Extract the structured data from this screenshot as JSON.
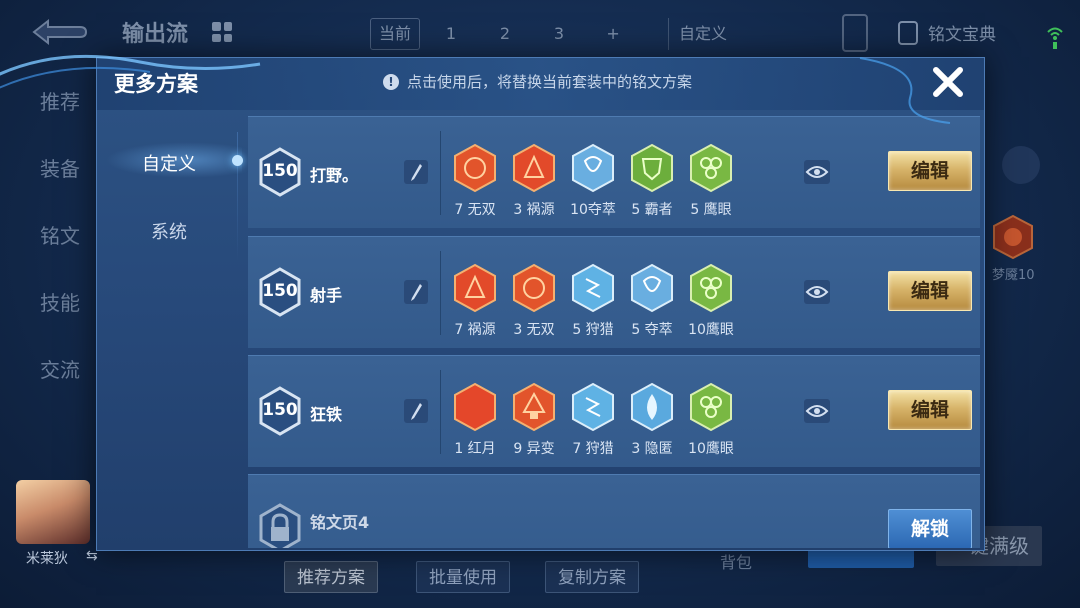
{
  "background": {
    "title": "输出流",
    "tabs": [
      "当前",
      "1",
      "2",
      "3",
      "+"
    ],
    "custom_tab": "自定义",
    "rune_book": "铭文宝典",
    "left_nav": [
      "推荐",
      "装备",
      "铭文",
      "技能",
      "交流"
    ],
    "right_rune_label": "梦魇10",
    "hero_name": "米莱狄",
    "swap_icon": "⇆",
    "bottom_buttons": [
      "推荐方案",
      "批量使用",
      "复制方案"
    ],
    "bag": "背包",
    "max_level": "一键满级"
  },
  "modal": {
    "title": "更多方案",
    "notice": "点击使用后，将替换当前套装中的铭文方案",
    "info_glyph": "!",
    "side_nav": [
      {
        "label": "自定义",
        "active": true
      },
      {
        "label": "系统",
        "active": false
      }
    ],
    "plans": [
      {
        "level": "150",
        "name": "打野。",
        "action": "编辑",
        "runes": [
          {
            "label": "7 无双",
            "color": "#e2542b",
            "icon": "wushuang-rune-icon"
          },
          {
            "label": "3 祸源",
            "color": "#e24a2a",
            "icon": "huoyuan-rune-icon"
          },
          {
            "label": "10夺萃",
            "color": "#69aee0",
            "icon": "duocui-rune-icon"
          },
          {
            "label": "5 霸者",
            "color": "#6cae3c",
            "icon": "bazhe-rune-icon"
          },
          {
            "label": "5 鹰眼",
            "color": "#79b843",
            "icon": "yingyan-rune-icon"
          }
        ]
      },
      {
        "level": "150",
        "name": "射手",
        "action": "编辑",
        "runes": [
          {
            "label": "7 祸源",
            "color": "#e24a2a",
            "icon": "huoyuan-rune-icon"
          },
          {
            "label": "3 无双",
            "color": "#e2542b",
            "icon": "wushuang-rune-icon"
          },
          {
            "label": "5 狩猎",
            "color": "#5fb2e4",
            "icon": "shoulie-rune-icon"
          },
          {
            "label": "5 夺萃",
            "color": "#69aee0",
            "icon": "duocui-rune-icon"
          },
          {
            "label": "10鹰眼",
            "color": "#79b843",
            "icon": "yingyan-rune-icon"
          }
        ]
      },
      {
        "level": "150",
        "name": "狂铁",
        "action": "编辑",
        "runes": [
          {
            "label": "1 红月",
            "color": "#e4472a",
            "icon": "hongyue-rune-icon"
          },
          {
            "label": "9 异变",
            "color": "#e2542b",
            "icon": "yibian-rune-icon"
          },
          {
            "label": "7 狩猎",
            "color": "#5fb2e4",
            "icon": "shoulie-rune-icon"
          },
          {
            "label": "3 隐匿",
            "color": "#5aa9de",
            "icon": "yinni-rune-icon"
          },
          {
            "label": "10鹰眼",
            "color": "#79b843",
            "icon": "yingyan-rune-icon"
          }
        ]
      }
    ],
    "locked_plan": {
      "name": "铭文页4",
      "action": "解锁"
    }
  },
  "colors": {
    "gold_button": "#d7b46a",
    "blue_button": "#2c68b3",
    "modal_bg": "#27497a"
  }
}
